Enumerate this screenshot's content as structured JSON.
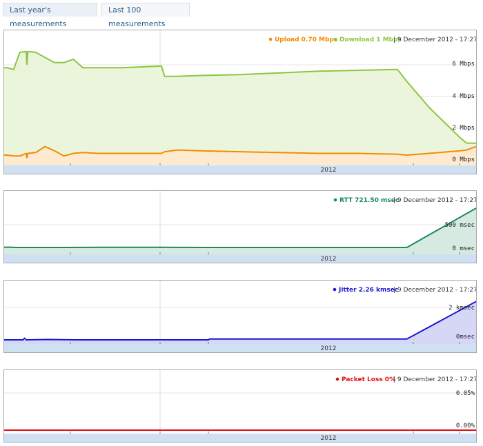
{
  "tabs": [
    {
      "label": "Last year's measurements",
      "active": true
    },
    {
      "label": "Last 100 measurements",
      "active": false
    }
  ],
  "charts": {
    "bandwidth": {
      "legend": [
        {
          "label": "Upload 0.70 Mbps",
          "color": "#f28c00"
        },
        {
          "label": "Download 1 Mbps",
          "color": "#8cc63f"
        }
      ],
      "date": "| 9 December 2012 - 17:27",
      "y_ticks": [
        "6 Mbps",
        "4 Mbps",
        "2 Mbps",
        "0 Mbps"
      ],
      "year_label": "2012"
    },
    "rtt": {
      "legend": [
        {
          "label": "RTT 721.50 msec",
          "color": "#1a8a5a"
        }
      ],
      "date": "| 9 December 2012 - 17:27",
      "y_ticks": [
        "500 msec",
        "0 msec"
      ],
      "year_label": "2012"
    },
    "jitter": {
      "legend": [
        {
          "label": "Jitter 2.26 kmsec",
          "color": "#1a1ad0"
        }
      ],
      "date": "| 9 December 2012 - 17:27",
      "y_ticks": [
        "2 kmsec",
        "0msec"
      ],
      "year_label": "2012"
    },
    "loss": {
      "legend": [
        {
          "label": "Packet Loss 0%",
          "color": "#e01010"
        }
      ],
      "date": "| 9 December 2012 - 17:27",
      "y_ticks": [
        "0.05%",
        "0.00%"
      ],
      "year_label": "2012"
    }
  },
  "chart_data": [
    {
      "type": "area",
      "y_unit": "Mbps",
      "ylim": [
        0,
        6.6
      ],
      "x": [
        0,
        2,
        6,
        10,
        14,
        14.5,
        15,
        20,
        26,
        32,
        38,
        44,
        50,
        60,
        75,
        100,
        102,
        110,
        125,
        150,
        175,
        200,
        225,
        250,
        256,
        270,
        290,
        294,
        300
      ],
      "series": [
        {
          "name": "Upload",
          "color": "#f28c00",
          "values": [
            0.2,
            0.2,
            0.15,
            0.15,
            0.3,
            0.05,
            0.3,
            0.35,
            0.7,
            0.45,
            0.15,
            0.3,
            0.35,
            0.3,
            0.3,
            0.3,
            0.4,
            0.5,
            0.45,
            0.4,
            0.35,
            0.3,
            0.3,
            0.25,
            0.2,
            0.3,
            0.45,
            0.5,
            0.7
          ]
        },
        {
          "name": "Download",
          "color": "#8cc63f",
          "values": [
            5.3,
            5.3,
            5.2,
            6.2,
            6.25,
            5.5,
            6.25,
            6.2,
            5.9,
            5.6,
            5.6,
            5.8,
            5.3,
            5.3,
            5.3,
            5.4,
            4.8,
            4.8,
            4.85,
            4.9,
            5.0,
            5.1,
            5.15,
            5.2,
            4.5,
            3.0,
            1.2,
            0.9,
            0.9
          ]
        }
      ]
    },
    {
      "type": "area",
      "y_unit": "msec",
      "ylim": [
        0,
        760
      ],
      "x": [
        0,
        3,
        8,
        35,
        60,
        100,
        130,
        170,
        210,
        256,
        300
      ],
      "series": [
        {
          "name": "RTT",
          "color": "#1a8a5a",
          "values": [
            5,
            5,
            0,
            0,
            2,
            2,
            0,
            0,
            0,
            0,
            721.5
          ]
        }
      ]
    },
    {
      "type": "area",
      "y_unit": "kmsec",
      "ylim": [
        0,
        2.6
      ],
      "x": [
        0,
        12,
        13,
        14,
        28,
        45,
        100,
        130,
        130.5,
        200,
        256,
        300
      ],
      "series": [
        {
          "name": "Jitter",
          "color": "#1a1ad0",
          "values": [
            0.0,
            0.0,
            0.1,
            0.0,
            0.02,
            0.0,
            0.0,
            0.0,
            0.05,
            0.05,
            0.05,
            2.26
          ]
        }
      ]
    },
    {
      "type": "line",
      "y_unit": "%",
      "ylim": [
        0,
        0.06
      ],
      "x": [
        0,
        300
      ],
      "series": [
        {
          "name": "Packet Loss",
          "color": "#e01010",
          "values": [
            0,
            0
          ]
        }
      ]
    }
  ]
}
